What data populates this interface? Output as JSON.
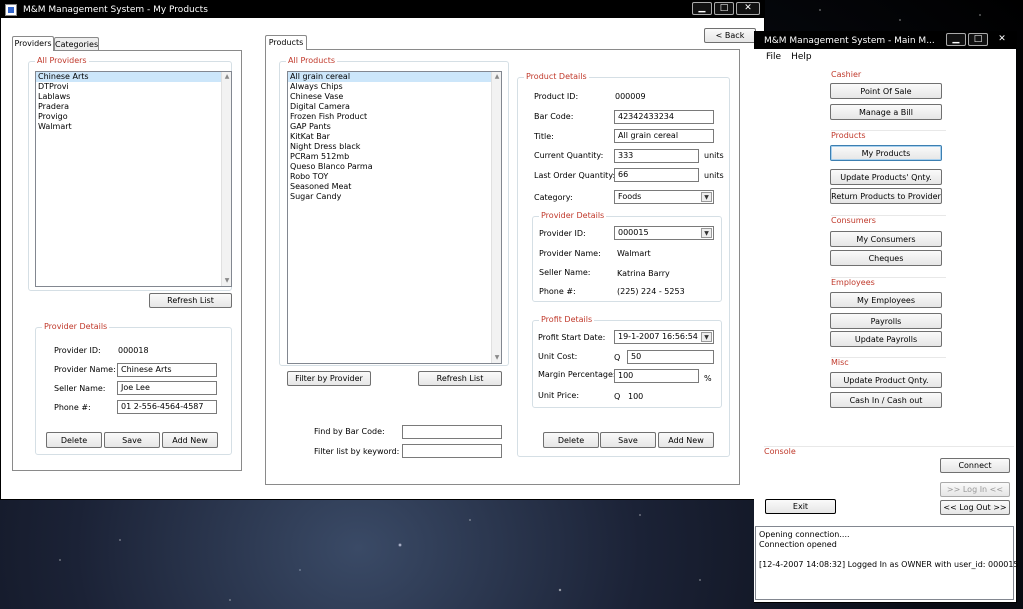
{
  "products_window": {
    "title": "M&M Management System - My Products",
    "back_label": "< Back",
    "tabs": [
      "Providers",
      "Categories"
    ],
    "providers_panel": {
      "all_providers_title": "All Providers",
      "providers": [
        "Chinese Arts",
        "DTProvi",
        "Lablaws",
        "Pradera",
        "Provigo",
        "Walmart"
      ],
      "selected_index": 0,
      "refresh_label": "Refresh List",
      "details_title": "Provider Details",
      "provider_id_label": "Provider ID:",
      "provider_id": "000018",
      "provider_name_label": "Provider Name:",
      "provider_name": "Chinese Arts",
      "seller_name_label": "Seller Name:",
      "seller_name": "Joe Lee",
      "phone_label": "Phone #:",
      "phone": "01 2-556-4564-4587",
      "delete_label": "Delete",
      "save_label": "Save",
      "add_new_label": "Add New"
    },
    "products_tab": "Products",
    "products_panel": {
      "all_products_title": "All Products",
      "products": [
        "All grain cereal",
        "Always Chips",
        "Chinese Vase",
        "Digital Camera",
        "Frozen Fish Product",
        "GAP Pants",
        "KitKat Bar",
        "Night Dress black",
        "PCRam 512mb",
        "Queso Blanco Parma",
        "Robo TOY",
        "Seasoned Meat",
        "Sugar Candy"
      ],
      "selected_index": 0,
      "filter_by_provider_label": "Filter by Provider",
      "refresh_label": "Refresh List",
      "find_by_barcode_label": "Find by Bar Code:",
      "find_by_barcode_value": "",
      "filter_keyword_label": "Filter list by keyword:",
      "filter_keyword_value": ""
    },
    "product_details": {
      "title": "Product Details",
      "product_id_label": "Product ID:",
      "product_id": "000009",
      "barcode_label": "Bar Code:",
      "barcode": "42342433234",
      "title_label": "Title:",
      "title_value": "All grain cereal",
      "current_qty_label": "Current Quantity:",
      "current_qty": "333",
      "last_order_qty_label": "Last Order Quantity:",
      "last_order_qty": "66",
      "units": "units",
      "category_label": "Category:",
      "category": "Foods",
      "provider_details_title": "Provider Details",
      "provider_id_label": "Provider ID:",
      "provider_id": "000015",
      "provider_name_label": "Provider Name:",
      "provider_name": "Walmart",
      "seller_name_label": "Seller Name:",
      "seller_name": "Katrina Barry",
      "phone_label": "Phone #:",
      "phone": "(225) 224 - 5253",
      "profit_details_title": "Profit Details",
      "profit_start_label": "Profit Start Date:",
      "profit_start": "19-1-2007 16:56:54",
      "unit_cost_label": "Unit Cost:",
      "currency_symbol": "Q",
      "unit_cost": "50",
      "margin_label": "Margin Percentage:",
      "margin": "100",
      "percent_symbol": "%",
      "unit_price_label": "Unit Price:",
      "unit_price": "100",
      "delete_label": "Delete",
      "save_label": "Save",
      "add_new_label": "Add New"
    }
  },
  "main_window": {
    "title": "M&M Management System - Main M...",
    "menu": [
      "File",
      "Help"
    ],
    "sections": {
      "cashier": "Cashier",
      "products": "Products",
      "consumers": "Consumers",
      "employees": "Employees",
      "misc": "Misc"
    },
    "buttons": {
      "point_of_sale": "Point Of Sale",
      "manage_bill": "Manage a Bill",
      "my_products": "My Products",
      "update_products_qty": "Update Products' Qnty.",
      "return_products": "Return Products to Provider",
      "my_consumers": "My Consumers",
      "cheques": "Cheques",
      "my_employees": "My Employees",
      "payrolls": "Payrolls",
      "update_payrolls": "Update Payrolls",
      "update_product_qty": "Update Product Qnty.",
      "cash_in_out": "Cash In / Cash out",
      "connect": "Connect",
      "log_in": ">> Log In <<",
      "log_out": "<< Log Out >>",
      "exit": "Exit"
    },
    "console_label": "Console",
    "console_lines": [
      "Opening connection....",
      "Connection opened",
      "",
      "[12-4-2007 14:08:32] Logged In as OWNER with user_id: 000015"
    ]
  },
  "colors": {
    "section_title": "#c0392b",
    "selection": "#cce6fa",
    "titlebar": "#000000"
  }
}
